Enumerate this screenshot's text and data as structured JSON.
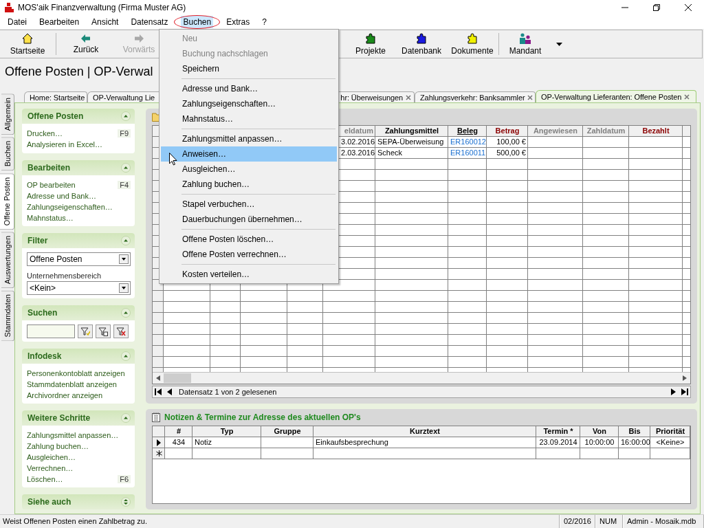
{
  "window": {
    "title": "MOS'aik Finanzverwaltung (Firma Muster AG)"
  },
  "menu_bar": [
    {
      "label": "Datei",
      "selected": false
    },
    {
      "label": "Bearbeiten",
      "selected": false
    },
    {
      "label": "Ansicht",
      "selected": false
    },
    {
      "label": "Datensatz",
      "selected": false
    },
    {
      "label": "Buchen",
      "selected": true
    },
    {
      "label": "Extras",
      "selected": false
    },
    {
      "label": "?",
      "selected": false
    }
  ],
  "toolbar": [
    {
      "label": "Startseite",
      "kind": "home",
      "disabled": false
    },
    {
      "label": "Zurück",
      "kind": "back",
      "disabled": false
    },
    {
      "label": "Vorwärts",
      "kind": "forward",
      "disabled": true
    },
    {
      "label": "Projekte",
      "kind": "puzzle",
      "color": "#1a8a1a",
      "disabled": false
    },
    {
      "label": "Datenbank",
      "kind": "puzzle",
      "color": "#1a1ae0",
      "disabled": false
    },
    {
      "label": "Dokumente",
      "kind": "puzzle",
      "color": "#f0f000",
      "disabled": false
    },
    {
      "label": "Mandant",
      "kind": "people",
      "disabled": false
    }
  ],
  "page_title": "Offene Posten | OP-Verwal",
  "tabs": [
    {
      "label": "Home: Startseite",
      "selected": false
    },
    {
      "label": "OP-Verwaltung Lie",
      "selected": false
    },
    {
      "label": "hr: Überweisungen",
      "selected": false,
      "closable": true
    },
    {
      "label": "Zahlungsverkehr: Banksammler",
      "selected": false,
      "closable": true
    },
    {
      "label": "OP-Verwaltung Lieferanten: Offene Posten",
      "selected": true,
      "closable": true
    }
  ],
  "side_tabs": [
    {
      "label": "Allgemein",
      "selected": false
    },
    {
      "label": "Buchen",
      "selected": false
    },
    {
      "label": "Offene Posten",
      "selected": true
    },
    {
      "label": "Auswertungen",
      "selected": false
    },
    {
      "label": "Stammdaten",
      "selected": false
    }
  ],
  "sidebar": [
    {
      "title": "Offene Posten",
      "kind": "links",
      "expanded": true,
      "items": [
        {
          "label": "Drucken…",
          "shortcut": "F9"
        },
        {
          "label": "Analysieren in Excel…"
        }
      ]
    },
    {
      "title": "Bearbeiten",
      "kind": "links",
      "expanded": true,
      "items": [
        {
          "label": "OP bearbeiten",
          "shortcut": "F4"
        },
        {
          "label": "Adresse und Bank…"
        },
        {
          "label": "Zahlungseigenschaften…"
        },
        {
          "label": "Mahnstatus…"
        }
      ]
    },
    {
      "title": "Filter",
      "kind": "filter",
      "expanded": true,
      "status": "Offene Posten",
      "area_label": "Unternehmensbereich",
      "area": "<Kein>"
    },
    {
      "title": "Suchen",
      "kind": "search",
      "expanded": true
    },
    {
      "title": "Infodesk",
      "kind": "links",
      "expanded": true,
      "items": [
        {
          "label": "Personenkontoblatt anzeigen"
        },
        {
          "label": "Stammdatenblatt anzeigen"
        },
        {
          "label": "Archivordner anzeigen"
        }
      ]
    },
    {
      "title": "Weitere Schritte",
      "kind": "links",
      "expanded": true,
      "items": [
        {
          "label": "Zahlungsmittel anpassen…"
        },
        {
          "label": "Zahlung buchen…"
        },
        {
          "label": "Ausgleichen…"
        },
        {
          "label": "Verrechnen…"
        },
        {
          "label": "Löschen…",
          "shortcut": "F6"
        }
      ]
    },
    {
      "title": "Siehe auch",
      "expanded": false
    }
  ],
  "grid": {
    "columns": [
      {
        "label": "eldatum",
        "kind": "inactive"
      },
      {
        "label": "Zahlungsmittel",
        "kind": "plain"
      },
      {
        "label": "Beleg",
        "kind": "sorted"
      },
      {
        "label": "Betrag",
        "kind": "required"
      },
      {
        "label": "Angewiesen",
        "kind": "inactive"
      },
      {
        "label": "Zahldatum",
        "kind": "inactive"
      },
      {
        "label": "Bezahlt",
        "kind": "required"
      }
    ],
    "rows": [
      {
        "cells": [
          "3.02.2016",
          "SEPA-Überweisung",
          "ER160012",
          "100,00 €"
        ]
      },
      {
        "cells": [
          "2.03.2016",
          "Scheck",
          "ER160011",
          "500,00 €"
        ]
      }
    ],
    "record_nav": "Datensatz 1 von 2 gelesenen"
  },
  "notes": {
    "title": "Notizen & Termine zur Adresse des aktuellen OP's",
    "columns": [
      "#",
      "Typ",
      "Gruppe",
      "Kurztext",
      "Termin *",
      "Von",
      "Bis",
      "Priorität"
    ],
    "rows": [
      {
        "current": true,
        "number": "434",
        "typ": "Notiz",
        "kurztext": "Einkaufsbesprechung",
        "termin": "23.09.2014",
        "von": "10:00:00",
        "bis": "16:00:00",
        "prioritaet": "<Keine>"
      }
    ]
  },
  "buchen_menu": [
    [
      {
        "label": "Neu",
        "disabled": true,
        "selected": false
      },
      {
        "label": "Buchung nachschlagen",
        "disabled": true,
        "selected": false
      },
      {
        "label": "Speichern",
        "disabled": false,
        "selected": false
      }
    ],
    [
      {
        "label": "Adresse und Bank…",
        "disabled": false,
        "selected": false
      },
      {
        "label": "Zahlungseigenschaften…",
        "disabled": false,
        "selected": false
      },
      {
        "label": "Mahnstatus…",
        "disabled": false,
        "selected": false
      }
    ],
    [
      {
        "label": "Zahlungsmittel anpassen…",
        "disabled": false,
        "selected": false
      },
      {
        "label": "Anweisen…",
        "disabled": false,
        "selected": true
      },
      {
        "label": "Ausgleichen…",
        "disabled": false,
        "selected": false
      },
      {
        "label": "Zahlung buchen…",
        "disabled": false,
        "selected": false
      }
    ],
    [
      {
        "label": "Stapel verbuchen…",
        "disabled": false,
        "selected": false
      },
      {
        "label": "Dauerbuchungen übernehmen…",
        "disabled": false,
        "selected": false
      }
    ],
    [
      {
        "label": "Offene Posten löschen…",
        "disabled": false,
        "selected": false
      },
      {
        "label": "Offene Posten verrechnen…",
        "disabled": false,
        "selected": false
      }
    ],
    [
      {
        "label": "Kosten verteilen…",
        "disabled": false,
        "selected": false
      }
    ]
  ],
  "status_bar": {
    "message": "Weist Offenen Posten einen Zahlbetrag zu.",
    "period": "02/2016",
    "keyboard": "NUM",
    "user": "Admin - Mosaik.mdb"
  }
}
